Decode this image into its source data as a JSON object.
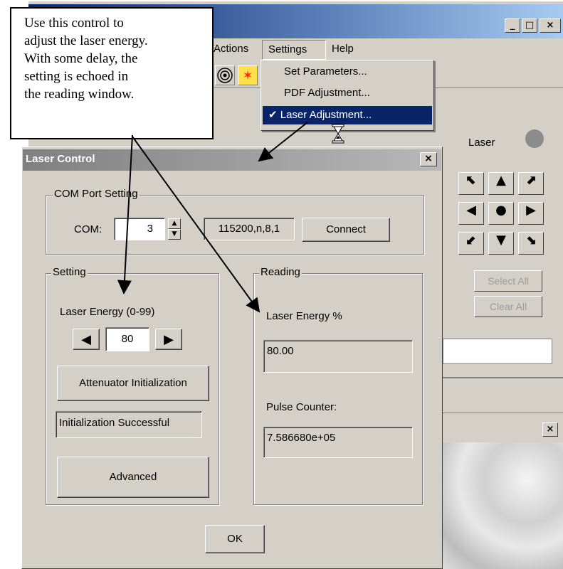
{
  "annotation": {
    "lines": [
      "Use this control to",
      "adjust the laser energy.",
      "With some delay, the",
      "setting is echoed  in",
      "the reading window."
    ]
  },
  "main_window": {
    "titlebar_buttons": {
      "minimize": "_",
      "maximize": "□",
      "close": "×"
    },
    "menu": {
      "actions": "Actions",
      "settings": "Settings",
      "help": "Help"
    },
    "settings_menu": {
      "items": [
        {
          "label": "Set Parameters...",
          "checked": false
        },
        {
          "label": "PDF Adjustment...",
          "checked": false
        },
        {
          "label": "Laser Adjustment...",
          "checked": true
        }
      ],
      "check_mark": "✔"
    },
    "laser_label": "Laser",
    "select_all": "Select All",
    "clear_all": "Clear All",
    "second_window_close": "×"
  },
  "dialog": {
    "title": "Laser Control",
    "close": "×",
    "com_group": "COM Port Setting",
    "com_label": "COM:",
    "com_value": "3",
    "baud_value": "115200,n,8,1",
    "connect": "Connect",
    "setting_group": "Setting",
    "energy_label": "Laser Energy (0-99)",
    "energy_value": "80",
    "attenuator_button": "Attenuator Initialization",
    "status_text": "Initialization Successful",
    "advanced_button": "Advanced",
    "reading_group": "Reading",
    "reading_energy_label": "Laser Energy %",
    "reading_energy_value": "80.00",
    "pulse_label": "Pulse Counter:",
    "pulse_value": "7.586680e+05",
    "ok_button": "OK"
  },
  "colors": {
    "title_active": "#0a246a",
    "title_inactive": "#808080",
    "face": "#d4d0c8",
    "laser_indicator": "#8c8c8c",
    "toolbar_star": "#ff2b00",
    "toolbar_star_bg": "#ffe14d"
  },
  "icons": [
    "spiral-icon",
    "laser-star-icon",
    "hourglass-cursor-icon"
  ]
}
